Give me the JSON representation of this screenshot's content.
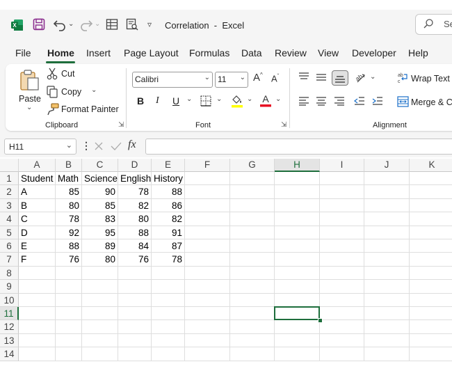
{
  "titlebar": {
    "title": "Correlation  -  Excel",
    "search_placeholder": "Se"
  },
  "menu": {
    "tabs": [
      "File",
      "Home",
      "Insert",
      "Page Layout",
      "Formulas",
      "Data",
      "Review",
      "View",
      "Developer",
      "Help"
    ],
    "active": "Home"
  },
  "ribbon": {
    "clipboard": {
      "paste": "Paste",
      "cut": "Cut",
      "copy": "Copy",
      "format_painter": "Format Painter",
      "group": "Clipboard"
    },
    "font": {
      "name": "Calibri",
      "size": "11",
      "bold": "B",
      "italic": "I",
      "underline": "U",
      "group": "Font"
    },
    "alignment": {
      "wrap_text": "Wrap Text",
      "merge": "Merge & C",
      "group": "Alignment"
    }
  },
  "formula_bar": {
    "name_box": "H11",
    "fx": "fx",
    "value": ""
  },
  "sheet": {
    "columns": [
      "A",
      "B",
      "C",
      "D",
      "E",
      "F",
      "G",
      "H",
      "I",
      "J",
      "K"
    ],
    "rows": [
      "1",
      "2",
      "3",
      "4",
      "5",
      "6",
      "7",
      "8",
      "9",
      "10",
      "11",
      "12",
      "13",
      "14"
    ],
    "selected_column": "H",
    "selected_row": "11",
    "headers": [
      "Student",
      "Math",
      "Science",
      "English",
      "History"
    ],
    "data": [
      [
        "A",
        "85",
        "90",
        "78",
        "88"
      ],
      [
        "B",
        "80",
        "85",
        "82",
        "86"
      ],
      [
        "C",
        "78",
        "83",
        "80",
        "82"
      ],
      [
        "D",
        "92",
        "95",
        "88",
        "91"
      ],
      [
        "E",
        "88",
        "89",
        "84",
        "87"
      ],
      [
        "F",
        "76",
        "80",
        "76",
        "78"
      ]
    ]
  },
  "colors": {
    "accent": "#1e6e3c",
    "excel_icon": "#107c41",
    "save_icon": "#8a2d8e",
    "highlight_yellow": "#ffff00",
    "font_red": "#e81123"
  }
}
